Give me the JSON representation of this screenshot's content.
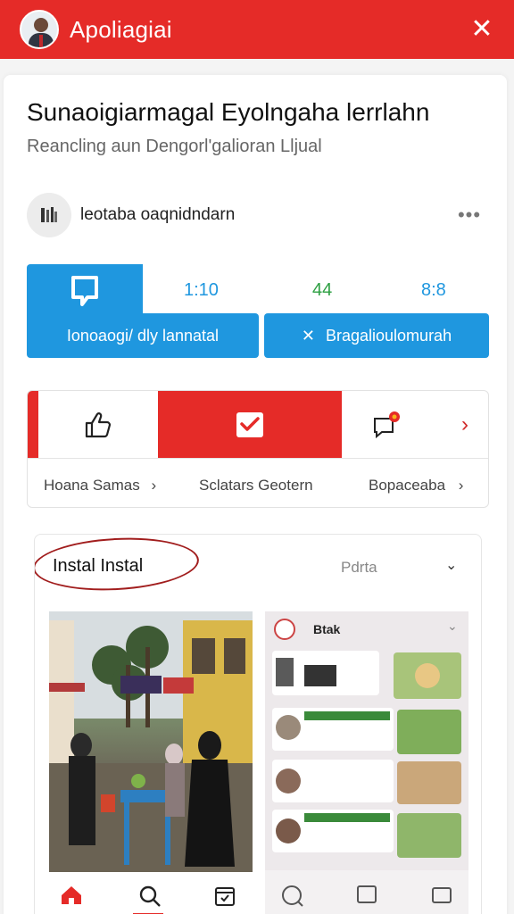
{
  "topbar": {
    "title": "Apoliagiai",
    "close_symbol": "✕",
    "brand_color": "#e52b28"
  },
  "post": {
    "headline": "Sunaoigiarmagal Eyolngaha lerrlahn",
    "subline": "Reancling aun Dengorl'galioran Lljual",
    "author": "leotaba oaqnidndarn",
    "more_symbol": "•••"
  },
  "stats": {
    "values": [
      "1:10",
      "44",
      "8:8"
    ],
    "colors": [
      "#1f97df",
      "#2ea043",
      "#1f97df"
    ]
  },
  "actions": {
    "primary_label": "Ionoaogi/ dly lannatal",
    "secondary_symbol": "✕",
    "secondary_label": "Bragalioulomurah"
  },
  "reactions": {
    "badge_color": "#e52b28",
    "next_symbol": "›",
    "links": [
      "Hoana Samas",
      "Sclatars Geotern",
      "Bopaceaba"
    ],
    "chevron": "›"
  },
  "feed": {
    "title": "Instal Instal",
    "filter": "Pdrta",
    "chevron": "⌄",
    "shot_title": "Btak",
    "shot_chevron": "⌄"
  },
  "icons": [
    "thumbs-up-icon",
    "check-mail-icon",
    "chat-icon",
    "home-icon",
    "search-icon",
    "calendar-icon"
  ]
}
